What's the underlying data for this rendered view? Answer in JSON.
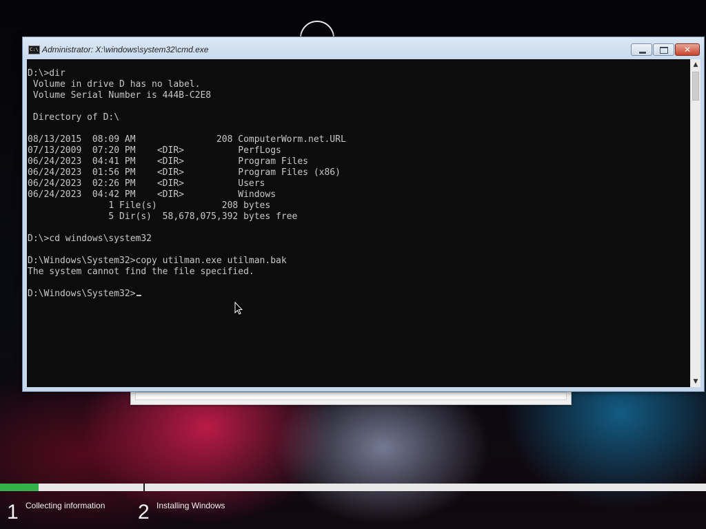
{
  "window": {
    "title": "Administrator: X:\\windows\\system32\\cmd.exe",
    "icon_text": "C:\\",
    "controls": {
      "minimize_icon": "minimize-icon",
      "maximize_icon": "maximize-icon",
      "close_icon": "close-icon",
      "close_glyph": "✕"
    }
  },
  "console": {
    "lines": [
      "D:\\>dir",
      " Volume in drive D has no label.",
      " Volume Serial Number is 444B-C2E8",
      "",
      " Directory of D:\\",
      "",
      "08/13/2015  08:09 AM               208 ComputerWorm.net.URL",
      "07/13/2009  07:20 PM    <DIR>          PerfLogs",
      "06/24/2023  04:41 PM    <DIR>          Program Files",
      "06/24/2023  01:56 PM    <DIR>          Program Files (x86)",
      "06/24/2023  02:26 PM    <DIR>          Users",
      "06/24/2023  04:42 PM    <DIR>          Windows",
      "               1 File(s)            208 bytes",
      "               5 Dir(s)  58,678,075,392 bytes free",
      "",
      "D:\\>cd windows\\system32",
      "",
      "D:\\Windows\\System32>copy utilman.exe utilman.bak",
      "The system cannot find the file specified.",
      ""
    ],
    "prompt": "D:\\Windows\\System32>"
  },
  "scrollbar": {
    "up_glyph": "▲",
    "down_glyph": "▼"
  },
  "setup": {
    "progress_fraction": 0.055,
    "steps": [
      {
        "number": "1",
        "label": "Collecting information"
      },
      {
        "number": "2",
        "label": "Installing Windows"
      }
    ]
  },
  "colors": {
    "console_bg": "#0c0c0c",
    "console_text": "#c8c8c8",
    "progress_green": "#33b24a",
    "titlebar": "#c9dbee"
  }
}
